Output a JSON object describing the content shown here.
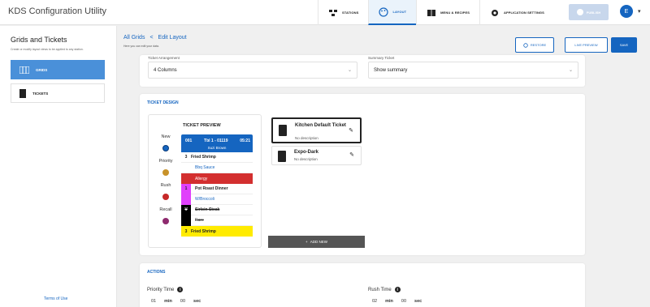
{
  "app": {
    "title": "KDS Configuration Utility"
  },
  "nav": [
    {
      "label": "STATIONS",
      "icon": "stations-icon"
    },
    {
      "label": "LAYOUT",
      "icon": "palette-icon",
      "active": true
    },
    {
      "label": "MENU & RECIPES",
      "icon": "book-icon"
    },
    {
      "label": "APPLICATION SETTINGS",
      "icon": "gear-icon"
    }
  ],
  "header": {
    "publish_label": "PUBLISH",
    "avatar_initial": "E"
  },
  "sidebar": {
    "title": "Grids and Tickets",
    "subtitle": "Create or modify layout views to be applied to any station.",
    "items": [
      {
        "label": "GRIDS",
        "active": true
      },
      {
        "label": "TICKETS"
      }
    ],
    "terms": "Terms of Use"
  },
  "breadcrumb": {
    "parent": "All Grids",
    "separator": "<",
    "current": "Edit Layout",
    "subtitle": "Here you can edit your data."
  },
  "actions_bar": {
    "restore": "RESTORE",
    "preview": "LIVE PREVIEW",
    "save": "SAVE"
  },
  "arrangement": {
    "ticket_label": "Ticket Arrangement",
    "ticket_value": "4 Columns",
    "summary_label": "Summary Ticket",
    "summary_value": "Show summary"
  },
  "ticket_design": {
    "title": "TICKET DESIGN",
    "preview_title": "TICKET PREVIEW",
    "legend": [
      {
        "label": "New",
        "color": "#1565c0"
      },
      {
        "label": "Priority",
        "color": "#c8922a"
      },
      {
        "label": "Rush",
        "color": "#c62828"
      },
      {
        "label": "Recall",
        "color": "#8e2a6e"
      }
    ],
    "ticket": {
      "number": "001",
      "table": "Tbl 1 - 01119",
      "time": "05:21",
      "server": "Suzi Brown",
      "lines": [
        {
          "qty": "3",
          "name": "Fried Shrimp"
        },
        {
          "mod": "Bbq Sauce"
        },
        {
          "allergy": "Allergy"
        },
        {
          "qty": "1",
          "name": "Pot Roast Dinner"
        },
        {
          "mod": "W/Broccoli"
        },
        {
          "qty": "V",
          "name": "Sirloin Steak"
        },
        {
          "mod": "Rare"
        },
        {
          "qty": "3",
          "name": "Fried Shrimp"
        }
      ]
    },
    "layouts": [
      {
        "title": "Kitchen Default Ticket",
        "desc": "No description"
      },
      {
        "title": "Expo-Dark",
        "desc": "No description"
      }
    ],
    "add_new": "ADD NEW"
  },
  "actions": {
    "title": "ACTIONS",
    "priority_label": "Priority Time",
    "rush_label": "Rush Time",
    "priority": {
      "min": "01",
      "sec": "00"
    },
    "rush": {
      "min": "02",
      "sec": "00"
    },
    "min_unit": "min",
    "sec_unit": "sec"
  }
}
